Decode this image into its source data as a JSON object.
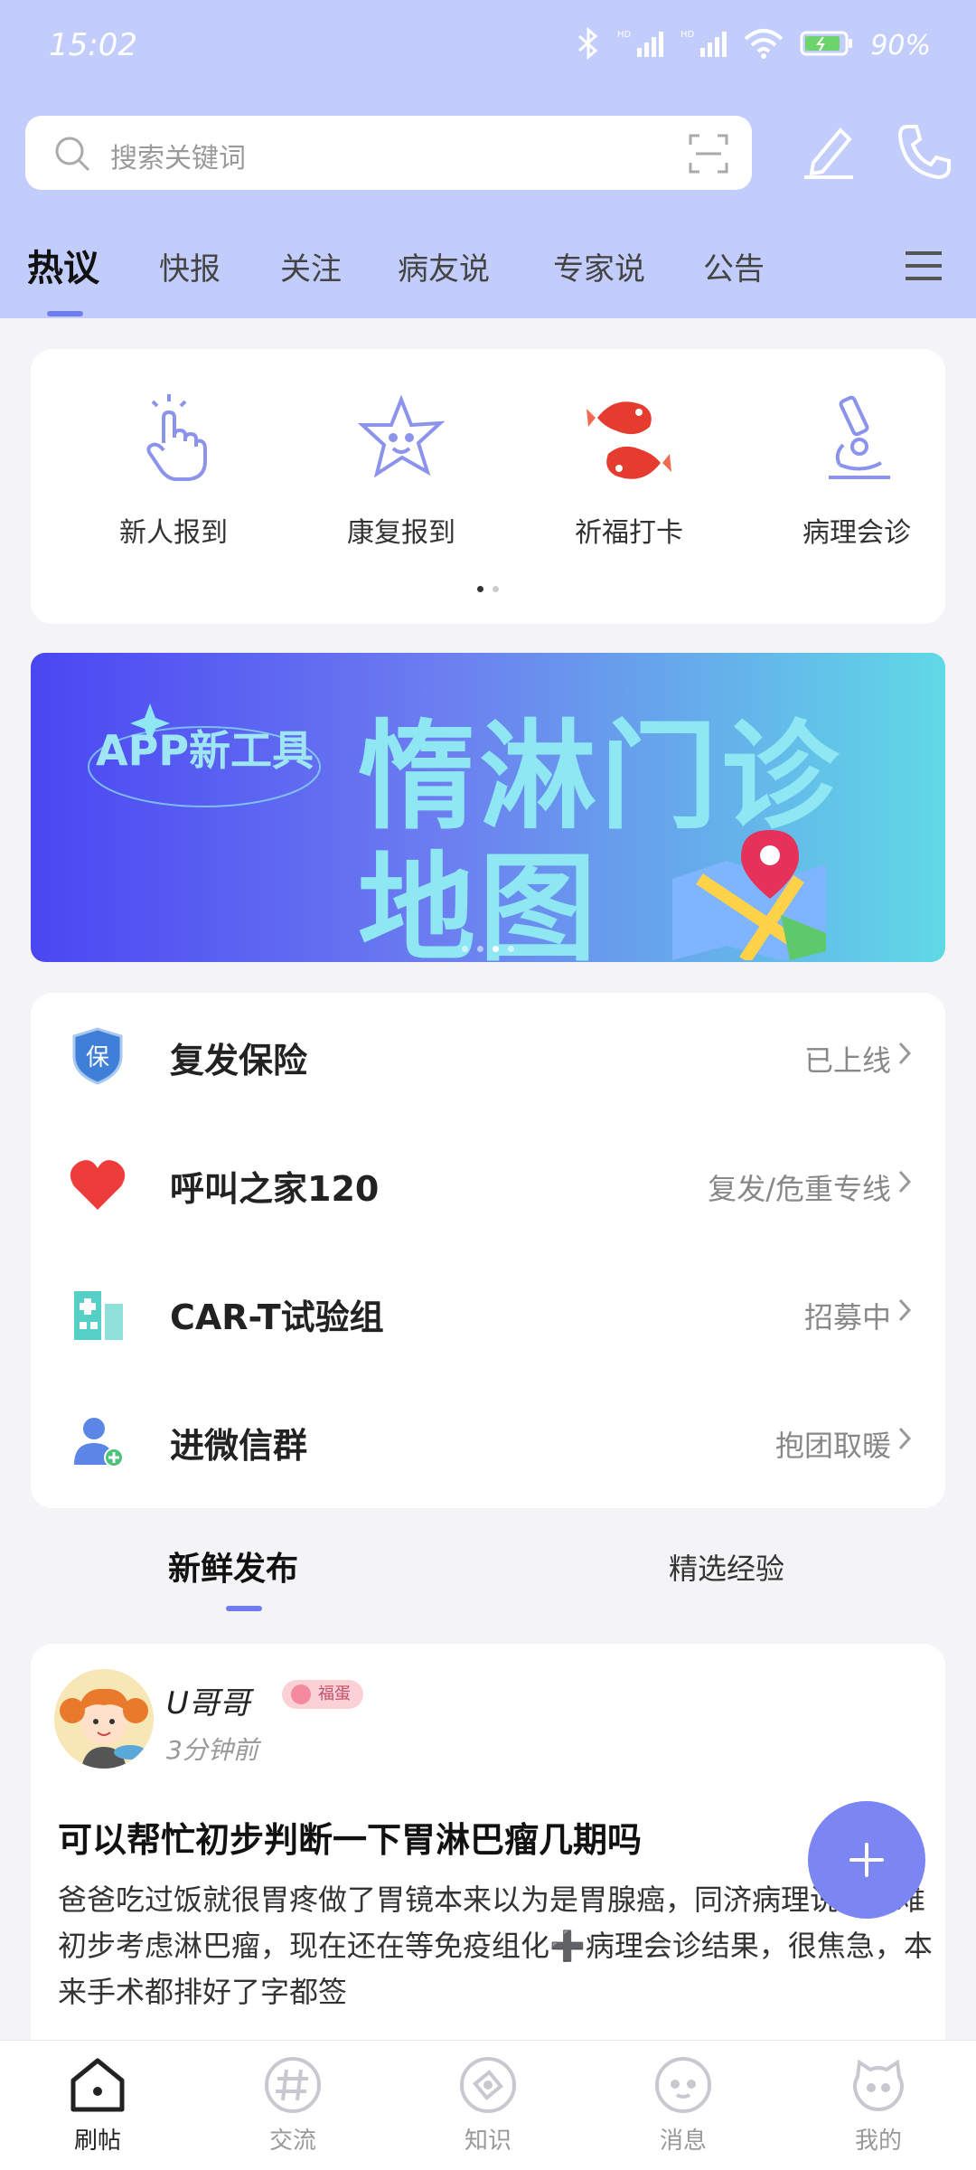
{
  "status_bar": {
    "time": "15:02",
    "battery": "90%"
  },
  "search": {
    "placeholder": "搜索关键词"
  },
  "tabs": [
    {
      "label": "热议",
      "active": true
    },
    {
      "label": "快报"
    },
    {
      "label": "关注"
    },
    {
      "label": "病友说"
    },
    {
      "label": "专家说"
    },
    {
      "label": "公告"
    }
  ],
  "quick_actions": [
    {
      "label": "新人报到",
      "icon": "tap-hand-icon"
    },
    {
      "label": "康复报到",
      "icon": "star-face-icon"
    },
    {
      "label": "祈福打卡",
      "icon": "koi-fish-icon"
    },
    {
      "label": "病理会诊",
      "icon": "microscope-icon"
    }
  ],
  "banner": {
    "small_label": "APP新工具",
    "line1": "惰淋门诊",
    "line2": "地图"
  },
  "services": [
    {
      "name": "复发保险",
      "status": "已上线",
      "icon": "insurance-shield-icon",
      "icon_text": "保"
    },
    {
      "name": "呼叫之家120",
      "status": "复发/危重专线",
      "icon": "heart-icon"
    },
    {
      "name": "CAR-T试验组",
      "status": "招募中",
      "icon": "hospital-icon"
    },
    {
      "name": "进微信群",
      "status": "抱团取暖",
      "icon": "add-user-icon"
    }
  ],
  "feed_tabs": [
    {
      "label": "新鲜发布",
      "active": true
    },
    {
      "label": "精选经验"
    }
  ],
  "post": {
    "username": "U哥哥",
    "badge": "福蛋",
    "time": "3分钟前",
    "title": "可以帮忙初步判断一下胃淋巴瘤几期吗",
    "body": "爸爸吃过饭就很胃疼做了胃镜本来以为是胃腺癌，同济病理说是疑难初步考虑淋巴瘤，现在还在等免疫组化➕病理会诊结果，很焦急，本来手术都排好了字都签"
  },
  "bottom_nav": [
    {
      "label": "刷帖",
      "icon": "home-icon",
      "active": true
    },
    {
      "label": "交流",
      "icon": "hashtag-icon"
    },
    {
      "label": "知识",
      "icon": "compass-icon"
    },
    {
      "label": "消息",
      "icon": "message-face-icon"
    },
    {
      "label": "我的",
      "icon": "profile-face-icon"
    }
  ],
  "colors": {
    "header_bg": "#c3cdfb",
    "accent": "#6f7cf0",
    "fab": "#7b86f2"
  }
}
